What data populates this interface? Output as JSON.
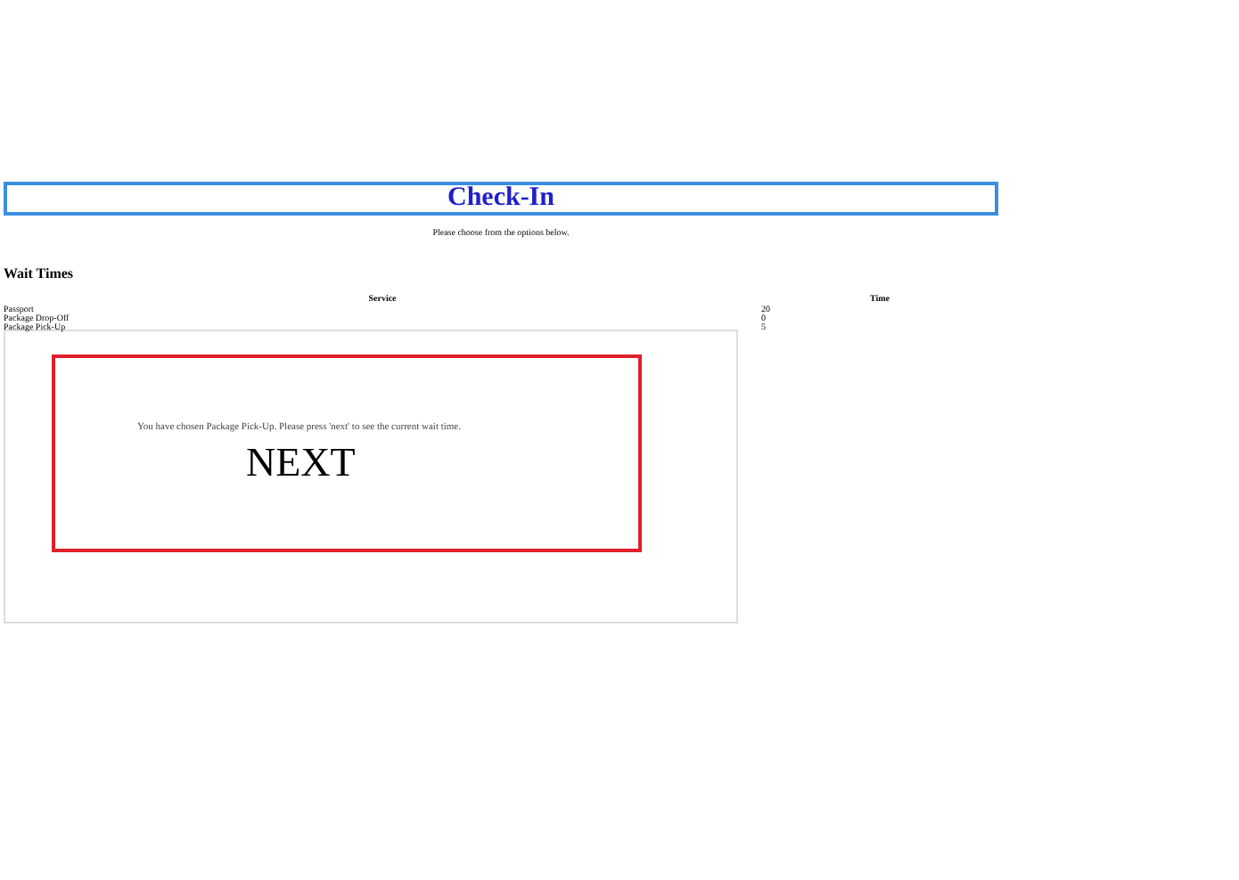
{
  "title": "Check-In",
  "instruction": "Please choose from the options below.",
  "wait_times": {
    "heading": "Wait Times",
    "columns": [
      "Service",
      "Time"
    ],
    "rows": [
      [
        "Passport",
        "20"
      ],
      [
        "Package Drop-Off",
        "0"
      ],
      [
        "Package Pick-Up",
        "5"
      ]
    ]
  },
  "dialog": {
    "message": "You have chosen Package Pick-Up. Please press 'next' to see the current wait time.",
    "button": "NEXT"
  }
}
